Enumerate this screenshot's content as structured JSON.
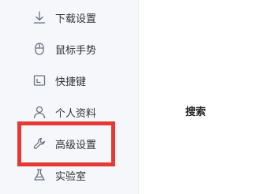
{
  "sidebar": {
    "items": [
      {
        "label": "下载设置",
        "icon": "download-icon"
      },
      {
        "label": "鼠标手势",
        "icon": "mouse-icon"
      },
      {
        "label": "快捷键",
        "icon": "shortcut-icon"
      },
      {
        "label": "个人资料",
        "icon": "user-icon"
      },
      {
        "label": "高级设置",
        "icon": "wrench-icon"
      },
      {
        "label": "实验室",
        "icon": "flask-icon"
      }
    ]
  },
  "main": {
    "title": "搜索"
  },
  "colors": {
    "highlight": "#e53935",
    "sidebar_bg": "#f5f7fb",
    "icon": "#6b7280",
    "text": "#333333"
  }
}
